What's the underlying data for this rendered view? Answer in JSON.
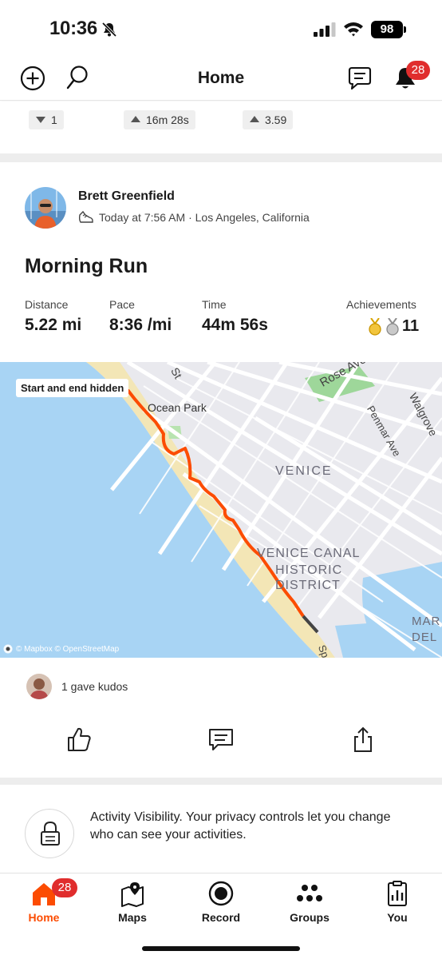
{
  "status_bar": {
    "time": "10:36",
    "battery": "98"
  },
  "nav": {
    "title": "Home",
    "notification_count": "28"
  },
  "prev_stats": {
    "chip1": "1",
    "chip2": "16m 28s",
    "chip3": "3.59"
  },
  "activity": {
    "athlete": "Brett Greenfield",
    "meta": "Today at 7:56 AM · Los Angeles, California",
    "title": "Morning Run",
    "stats": {
      "distance_label": "Distance",
      "distance": "5.22 mi",
      "pace_label": "Pace",
      "pace": "8:36 /mi",
      "time_label": "Time",
      "time": "44m 56s",
      "achievements_label": "Achievements",
      "achievements": "11"
    },
    "map": {
      "tag": "Start and end hidden",
      "labels": {
        "ocean_park": "Ocean Park",
        "venice": "VENICE",
        "canal_1": "VENICE CANAL",
        "canal_2": "HISTORIC",
        "canal_3": "DISTRICT",
        "rose": "Rose Ave",
        "penmar": "Penmar Ave",
        "walgrove": "Walgrove",
        "st": "St",
        "mar": "MAR",
        "del": "DEL",
        "sp": "Sp"
      },
      "attribution": "© Mapbox © OpenStreetMap",
      "route_color": "#fc4c02"
    },
    "kudos_text": "1 gave kudos"
  },
  "privacy": {
    "text": "Activity Visibility. Your privacy controls let you change who can see your activities."
  },
  "tabs": [
    {
      "label": "Home",
      "badge": "28"
    },
    {
      "label": "Maps"
    },
    {
      "label": "Record"
    },
    {
      "label": "Groups"
    },
    {
      "label": "You"
    }
  ],
  "colors": {
    "accent": "#fc4c02",
    "badge": "#e02d2d"
  }
}
